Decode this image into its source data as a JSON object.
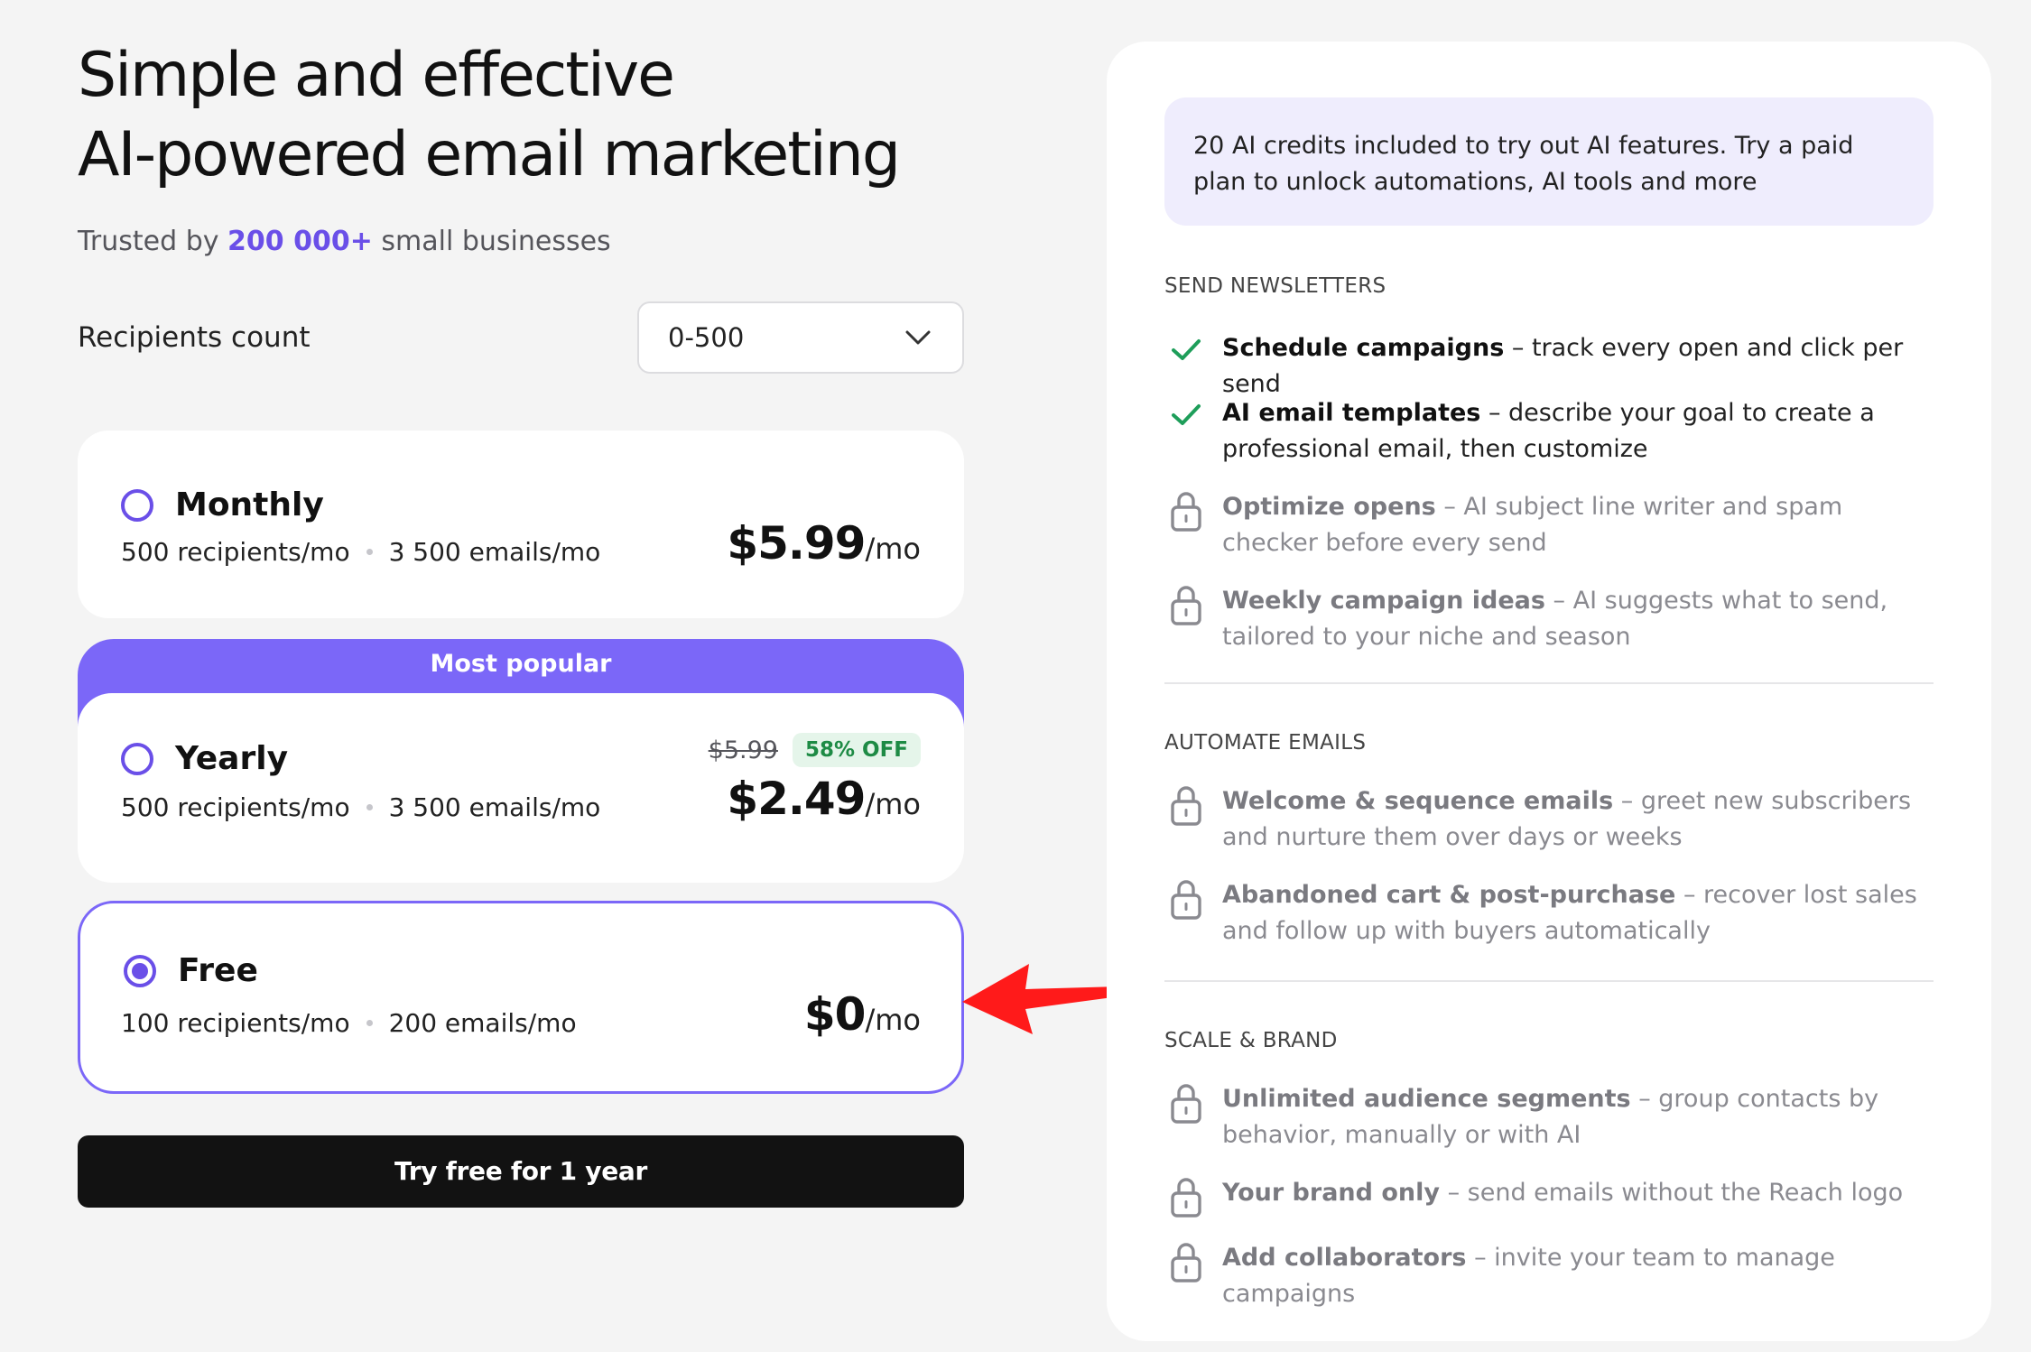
{
  "hero": {
    "title_line1": "Simple and effective",
    "title_line2": "AI-powered email marketing",
    "trusted_prefix": "Trusted by ",
    "trusted_highlight": "200 000+",
    "trusted_suffix": " small businesses"
  },
  "recipients": {
    "label": "Recipients count",
    "selected": "0-500"
  },
  "plans": {
    "monthly": {
      "name": "Monthly",
      "recipients": "500 recipients/mo",
      "emails": "3 500 emails/mo",
      "price": "$5.99",
      "per": "/mo",
      "selected": false
    },
    "yearly": {
      "banner": "Most popular",
      "name": "Yearly",
      "recipients": "500 recipients/mo",
      "emails": "3 500 emails/mo",
      "old_price": "$5.99",
      "discount": "58% OFF",
      "price": "$2.49",
      "per": "/mo",
      "selected": false
    },
    "free": {
      "name": "Free",
      "recipients": "100 recipients/mo",
      "emails": "200 emails/mo",
      "price": "$0",
      "per": "/mo",
      "selected": true
    }
  },
  "cta": {
    "label": "Try free for 1 year"
  },
  "colors": {
    "accent": "#6a4fe8",
    "banner": "#7b67f8",
    "check": "#1e9e5a",
    "annotation_arrow": "#ff1a1a"
  },
  "features": {
    "notice": "20 AI credits included to try out AI features. Try a paid plan to unlock automations, AI tools and more",
    "sections": [
      {
        "title": "SEND NEWSLETTERS",
        "items": [
          {
            "icon": "check-icon",
            "bold": "Schedule campaigns",
            "rest": " – track every open and click per send"
          },
          {
            "icon": "check-icon",
            "bold": "AI email templates",
            "rest": " – describe your goal to create a professional email, then customize"
          },
          {
            "icon": "lock-icon",
            "bold": "Optimize opens",
            "rest": " – AI subject line writer and spam checker before every send"
          },
          {
            "icon": "lock-icon",
            "bold": "Weekly campaign ideas",
            "rest": " – AI suggests what to send, tailored to your niche and season"
          }
        ]
      },
      {
        "title": "AUTOMATE EMAILS",
        "items": [
          {
            "icon": "lock-icon",
            "bold": "Welcome & sequence emails",
            "rest": " – greet new subscribers and nurture them over days or weeks"
          },
          {
            "icon": "lock-icon",
            "bold": "Abandoned cart & post-purchase",
            "rest": " – recover lost sales and follow up with buyers automatically"
          }
        ]
      },
      {
        "title": "SCALE & BRAND",
        "items": [
          {
            "icon": "lock-icon",
            "bold": "Unlimited audience segments",
            "rest": " – group contacts by behavior, manually or with AI"
          },
          {
            "icon": "lock-icon",
            "bold": "Your brand only",
            "rest": " – send emails without the Reach logo"
          },
          {
            "icon": "lock-icon",
            "bold": "Add collaborators",
            "rest": " – invite your team to manage campaigns"
          }
        ]
      }
    ]
  }
}
